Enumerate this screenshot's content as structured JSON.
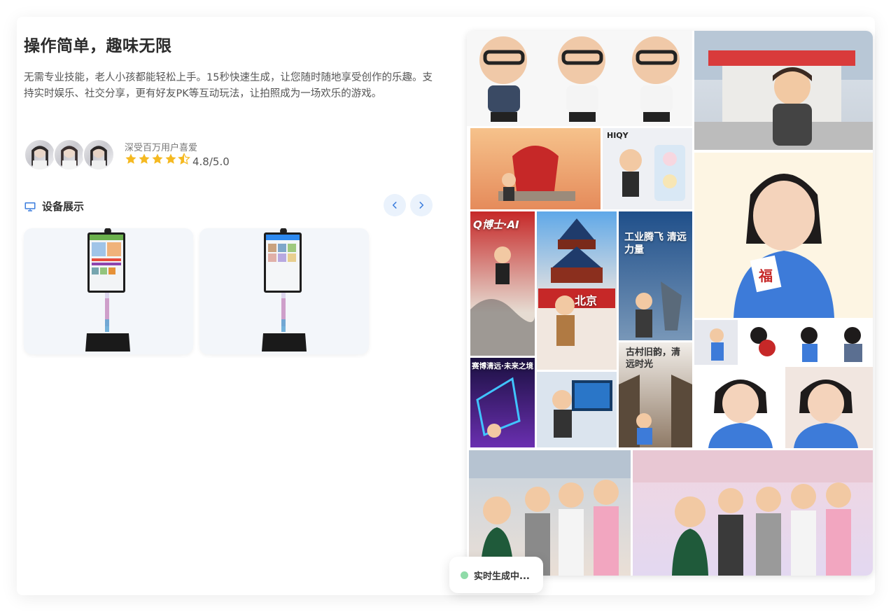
{
  "hero": {
    "title": "操作简单，趣味无限",
    "description": "无需专业技能，老人小孩都能轻松上手。15秒快速生成，让您随时随地享受创作的乐趣。支持实时娱乐、社交分享，更有好友PK等互动玩法，让拍照成为一场欢乐的游戏。"
  },
  "social_proof": {
    "label": "深受百万用户喜爱",
    "rating_text": "4.8/5.0",
    "rating": 4.5,
    "star_color": "#f5b921"
  },
  "devices": {
    "section_title": "设备展示",
    "icon": "monitor-icon",
    "accent": "#3b7ddd",
    "prev_icon": "chevron-left-icon",
    "next_icon": "chevron-right-icon"
  },
  "gallery": {
    "tiles": [
      {
        "id": "bald-figures",
        "text": ""
      },
      {
        "id": "campus-boy",
        "text": ""
      },
      {
        "id": "red-monument",
        "text": ""
      },
      {
        "id": "toy-package",
        "text": "HIQY"
      },
      {
        "id": "q-doctor-ai",
        "text": "Q博士·AI"
      },
      {
        "id": "beijing",
        "text": "北京"
      },
      {
        "id": "industry",
        "text": "工业腾飞 清远力量"
      },
      {
        "id": "girl-fu",
        "text": "福"
      },
      {
        "id": "sticker-row",
        "text": ""
      },
      {
        "id": "expo",
        "text": "赛博清远·未来之境"
      },
      {
        "id": "computer-boy",
        "text": ""
      },
      {
        "id": "old-village",
        "text": "古村旧韵，清远时光"
      },
      {
        "id": "girl-pair",
        "text": ""
      },
      {
        "id": "group-left",
        "text": ""
      },
      {
        "id": "group-right",
        "text": ""
      }
    ]
  },
  "status": {
    "text": "实时生成中...",
    "dot_color": "#8fdba8"
  }
}
